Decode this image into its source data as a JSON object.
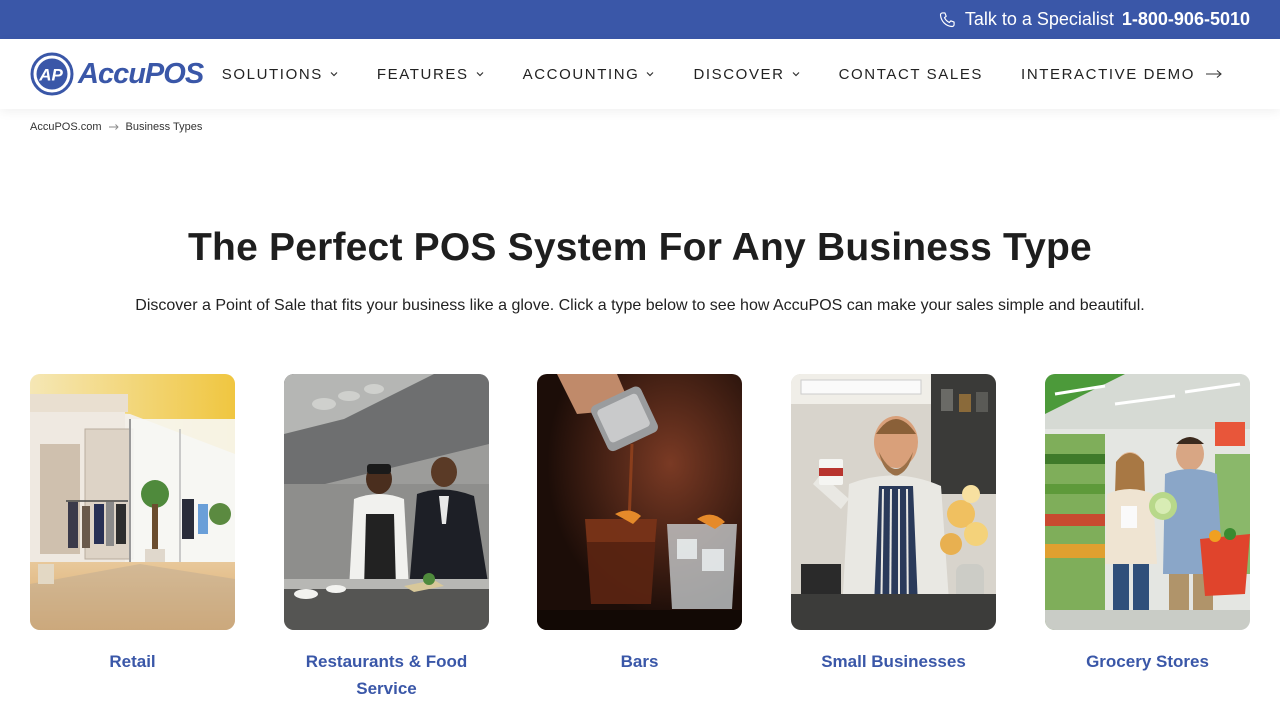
{
  "topbar": {
    "phone_prefix": "Talk to a Specialist",
    "phone_number": "1-800-906-5010"
  },
  "brand": {
    "logo_mark": "AP",
    "logo_text": "AccuPOS"
  },
  "nav": {
    "solutions": "SOLUTIONS",
    "features": "FEATURES",
    "accounting": "ACCOUNTING",
    "discover": "DISCOVER",
    "contact": "CONTACT SALES",
    "demo": "INTERACTIVE DEMO"
  },
  "breadcrumb": {
    "home": "AccuPOS.com",
    "current": "Business Types"
  },
  "hero": {
    "title": "The Perfect POS System For Any Business Type",
    "description": "Discover a Point of Sale that fits your business like a glove. Click a type below to see how AccuPOS can make your sales simple and beautiful."
  },
  "business_types": [
    {
      "label": "Retail"
    },
    {
      "label": "Restaurants & Food Service"
    },
    {
      "label": "Bars"
    },
    {
      "label": "Small Businesses"
    },
    {
      "label": "Grocery Stores"
    }
  ],
  "colors": {
    "brand_blue": "#3a57a8",
    "text_dark": "#1e1e1e"
  }
}
